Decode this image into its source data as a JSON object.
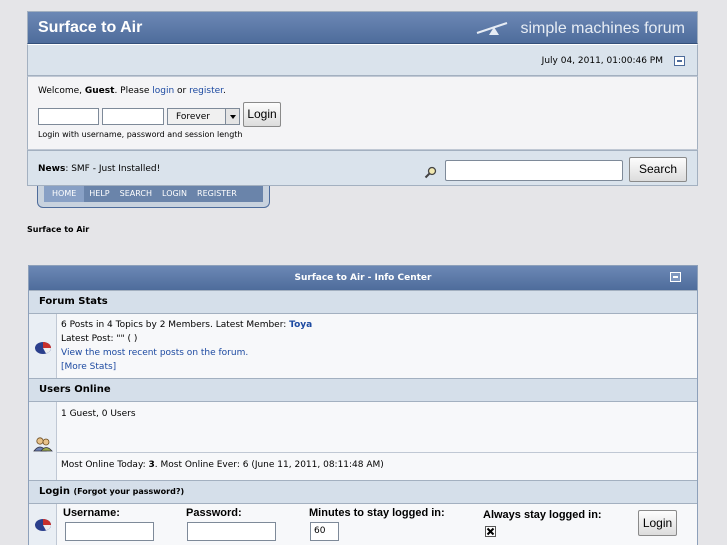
{
  "header": {
    "forum_title": "Surface to Air",
    "smf_logo_text": "simple machines forum",
    "date": "July 04, 2011, 01:00:46 PM"
  },
  "welcome": {
    "prefix": "Welcome, ",
    "guest": "Guest",
    "mid": ". Please ",
    "login_link": "login",
    "or": " or ",
    "register_link": "register",
    "end": ".",
    "session_length": "Forever",
    "login_button": "Login",
    "note": "Login with username, password and session length"
  },
  "news": {
    "label": "News",
    "text": ": SMF - Just Installed!",
    "search_button": "Search"
  },
  "menu": {
    "items": [
      "HOME",
      "HELP",
      "SEARCH",
      "LOGIN",
      "REGISTER"
    ]
  },
  "breadcrumb": "Surface to Air",
  "info_center": {
    "title": "Surface to Air - Info Center",
    "forum_stats": {
      "heading": "Forum Stats",
      "line1_prefix": "6 Posts in 4 Topics by 2 Members. Latest Member: ",
      "latest_member": "Toya",
      "line2": "Latest Post: \"\" ( )",
      "recent_link": "View the most recent posts on the forum.",
      "more_stats": "[More Stats]"
    },
    "users_online": {
      "heading": "Users Online",
      "guests": "1 Guest, 0 Users",
      "most_prefix": "Most Online Today: ",
      "most_today": "3",
      "most_suffix": ". Most Online Ever: 6 (June 11, 2011, 08:11:48 AM)"
    },
    "login": {
      "heading": "Login",
      "forgot": "(Forgot your password?)",
      "username_label": "Username:",
      "password_label": "Password:",
      "minutes_label": "Minutes to stay logged in:",
      "minutes_value": "60",
      "always_label": "Always stay logged in:",
      "button": "Login"
    }
  },
  "colors": {
    "header_blue": "#4e6c9b",
    "link_blue": "#1d4aa1",
    "bar_bg": "#dae3ec"
  }
}
